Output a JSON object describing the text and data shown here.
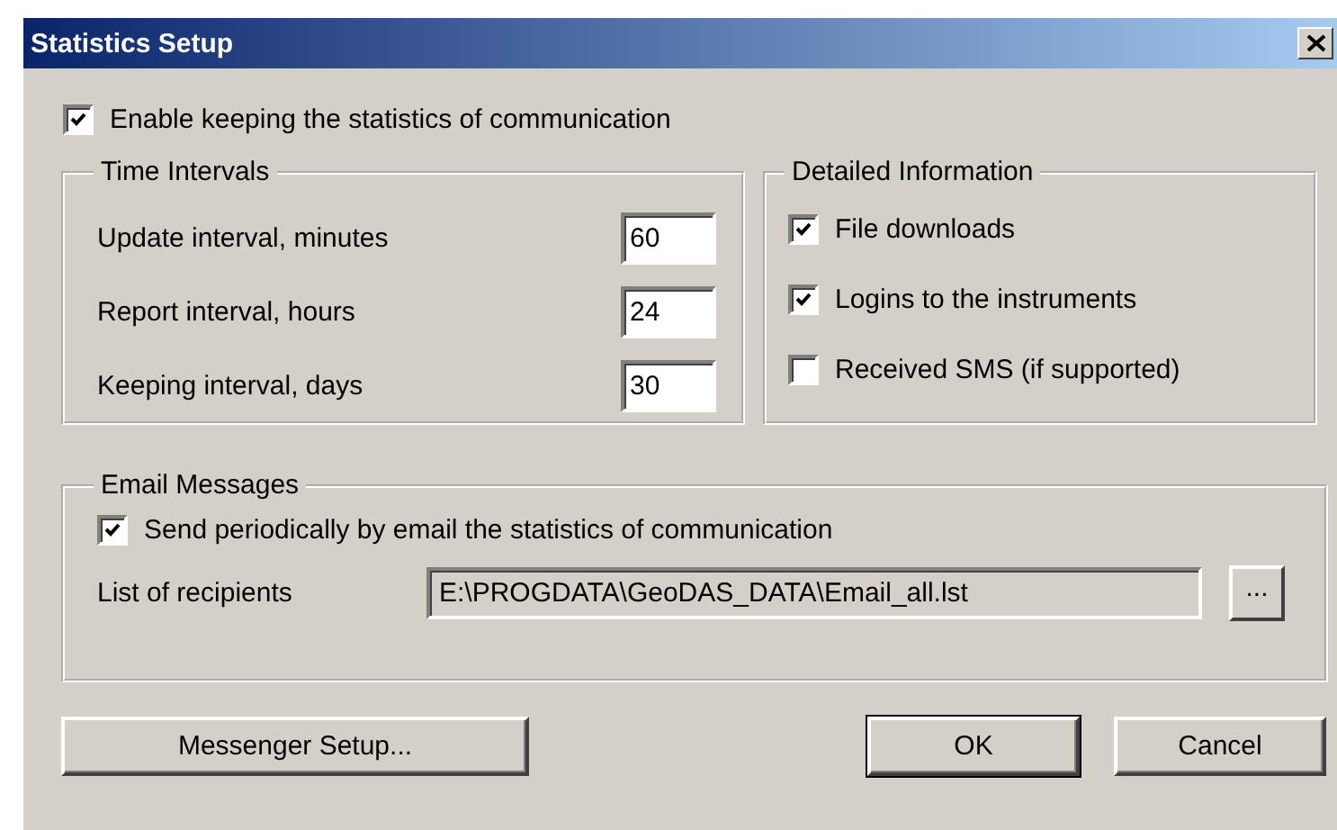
{
  "window": {
    "title": "Statistics Setup"
  },
  "enable_statistics": {
    "label": "Enable keeping the statistics of communication",
    "checked": true
  },
  "time_intervals": {
    "title": "Time Intervals",
    "rows": [
      {
        "label": "Update interval, minutes",
        "value": "60"
      },
      {
        "label": "Report interval, hours",
        "value": "24"
      },
      {
        "label": "Keeping interval, days",
        "value": "30"
      }
    ]
  },
  "detailed_information": {
    "title": "Detailed Information",
    "items": [
      {
        "label": "File downloads",
        "checked": true
      },
      {
        "label": "Logins to the instruments",
        "checked": true
      },
      {
        "label": "Received SMS (if supported)",
        "checked": false
      }
    ]
  },
  "email_messages": {
    "title": "Email Messages",
    "send": {
      "label": "Send periodically by email the statistics of communication",
      "checked": true
    },
    "recipients_label": "List of recipients",
    "recipients_value": "E:\\PROGDATA\\GeoDAS_DATA\\Email_all.lst",
    "browse_button": "..."
  },
  "buttons": [
    {
      "label": "Messenger Setup...",
      "default": false
    },
    {
      "label": "OK",
      "default": true
    },
    {
      "label": "Cancel",
      "default": false
    }
  ]
}
